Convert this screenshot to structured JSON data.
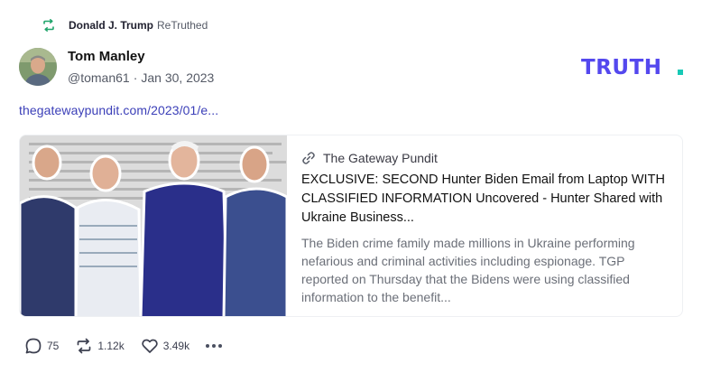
{
  "retruth": {
    "name": "Donald J. Trump",
    "label": "ReTruthed"
  },
  "author": {
    "name": "Tom Manley",
    "handle": "@toman61",
    "separator": "·",
    "date": "Jan 30, 2023"
  },
  "brand": {
    "logo_text": "TRUTH",
    "accent": "#5448ee",
    "dot": "#17c9b6"
  },
  "post": {
    "link_text": "thegatewaypundit.com/2023/01/e..."
  },
  "card": {
    "source": "The Gateway Pundit",
    "title": "EXCLUSIVE: SECOND Hunter Biden Email from Laptop WITH CLASSIFIED INFORMATION Uncovered - Hunter Shared with Ukraine Business...",
    "description": "The Biden crime family made millions in Ukraine performing nefarious and criminal activities including espionage. TGP reported on Thursday that the Bidens were using classified information to the benefit..."
  },
  "actions": {
    "replies": "75",
    "retruths": "1.12k",
    "likes": "3.49k",
    "icons": [
      "reply-icon",
      "retruth-icon",
      "like-icon",
      "more-icon"
    ]
  },
  "colors": {
    "retruth_green": "#1fa46a",
    "link_blue": "#3b3fb8",
    "muted": "#555a66"
  }
}
